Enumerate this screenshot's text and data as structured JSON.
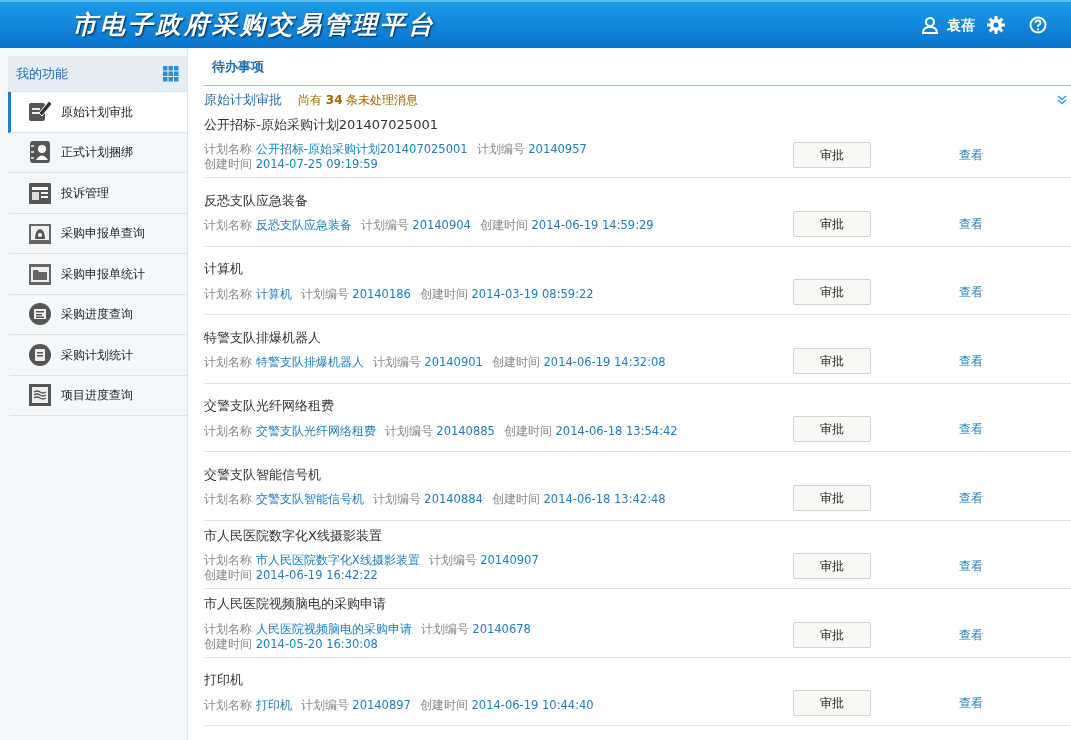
{
  "header": {
    "title": "市电子政府采购交易管理平台",
    "user": "袁蓓"
  },
  "sidebar": {
    "title": "我的功能",
    "items": [
      {
        "label": "原始计划审批",
        "selected": true
      },
      {
        "label": "正式计划捆绑",
        "selected": false
      },
      {
        "label": "投诉管理",
        "selected": false
      },
      {
        "label": "采购申报单查询",
        "selected": false
      },
      {
        "label": "采购申报单统计",
        "selected": false
      },
      {
        "label": "采购进度查询",
        "selected": false
      },
      {
        "label": "采购计划统计",
        "selected": false
      },
      {
        "label": "项目进度查询",
        "selected": false
      }
    ]
  },
  "main": {
    "title": "待办事项",
    "section": "原始计划审批",
    "notice": "尚有 **34** 条未处理消息",
    "items": [
      {
        "title": "公开招标-原始采购计划201407025001",
        "fields": [
          {
            "label": "计划名称",
            "value": "公开招标-原始采购计划201407025001"
          },
          {
            "label": "计划编号",
            "value": "20140957"
          },
          {
            "label": "创建时间",
            "value": "2014-07-25 09:19:59"
          }
        ],
        "approve": "审批",
        "view": "查看"
      },
      {
        "title": "反恐支队应急装备",
        "fields": [
          {
            "label": "计划名称",
            "value": "反恐支队应急装备"
          },
          {
            "label": "计划编号",
            "value": "20140904"
          },
          {
            "label": "创建时间",
            "value": "2014-06-19 14:59:29"
          }
        ],
        "approve": "审批",
        "view": "查看"
      },
      {
        "title": "计算机",
        "fields": [
          {
            "label": "计划名称",
            "value": "计算机"
          },
          {
            "label": "计划编号",
            "value": "20140186"
          },
          {
            "label": "创建时间",
            "value": "2014-03-19 08:59:22"
          }
        ],
        "approve": "审批",
        "view": "查看"
      },
      {
        "title": "特警支队排爆机器人",
        "fields": [
          {
            "label": "计划名称",
            "value": "特警支队排爆机器人"
          },
          {
            "label": "计划编号",
            "value": "20140901"
          },
          {
            "label": "创建时间",
            "value": "2014-06-19 14:32:08"
          }
        ],
        "approve": "审批",
        "view": "查看"
      },
      {
        "title": "交警支队光纤网络租费",
        "fields": [
          {
            "label": "计划名称",
            "value": "交警支队光纤网络租费"
          },
          {
            "label": "计划编号",
            "value": "20140885"
          },
          {
            "label": "创建时间",
            "value": "2014-06-18 13:54:42"
          }
        ],
        "approve": "审批",
        "view": "查看"
      },
      {
        "title": "交警支队智能信号机",
        "fields": [
          {
            "label": "计划名称",
            "value": "交警支队智能信号机"
          },
          {
            "label": "计划编号",
            "value": "20140884"
          },
          {
            "label": "创建时间",
            "value": "2014-06-18 13:42:48"
          }
        ],
        "approve": "审批",
        "view": "查看"
      },
      {
        "title": "市人民医院数字化X线摄影装置",
        "fields": [
          {
            "label": "计划名称",
            "value": "市人民医院数字化X线摄影装置"
          },
          {
            "label": "计划编号",
            "value": "20140907"
          },
          {
            "label": "创建时间",
            "value": "2014-06-19 16:42:22"
          }
        ],
        "approve": "审批",
        "view": "查看"
      },
      {
        "title": "市人民医院视频脑电的采购申请",
        "fields": [
          {
            "label": "计划名称",
            "value": "人民医院视频脑电的采购申请"
          },
          {
            "label": "计划编号",
            "value": "20140678"
          },
          {
            "label": "创建时间",
            "value": "2014-05-20 16:30:08"
          }
        ],
        "approve": "审批",
        "view": "查看"
      },
      {
        "title": "打印机",
        "fields": [
          {
            "label": "计划名称",
            "value": "打印机"
          },
          {
            "label": "计划编号",
            "value": "20140897"
          },
          {
            "label": "创建时间",
            "value": "2014-06-19 10:44:40"
          }
        ],
        "approve": "审批",
        "view": "查看"
      }
    ]
  }
}
